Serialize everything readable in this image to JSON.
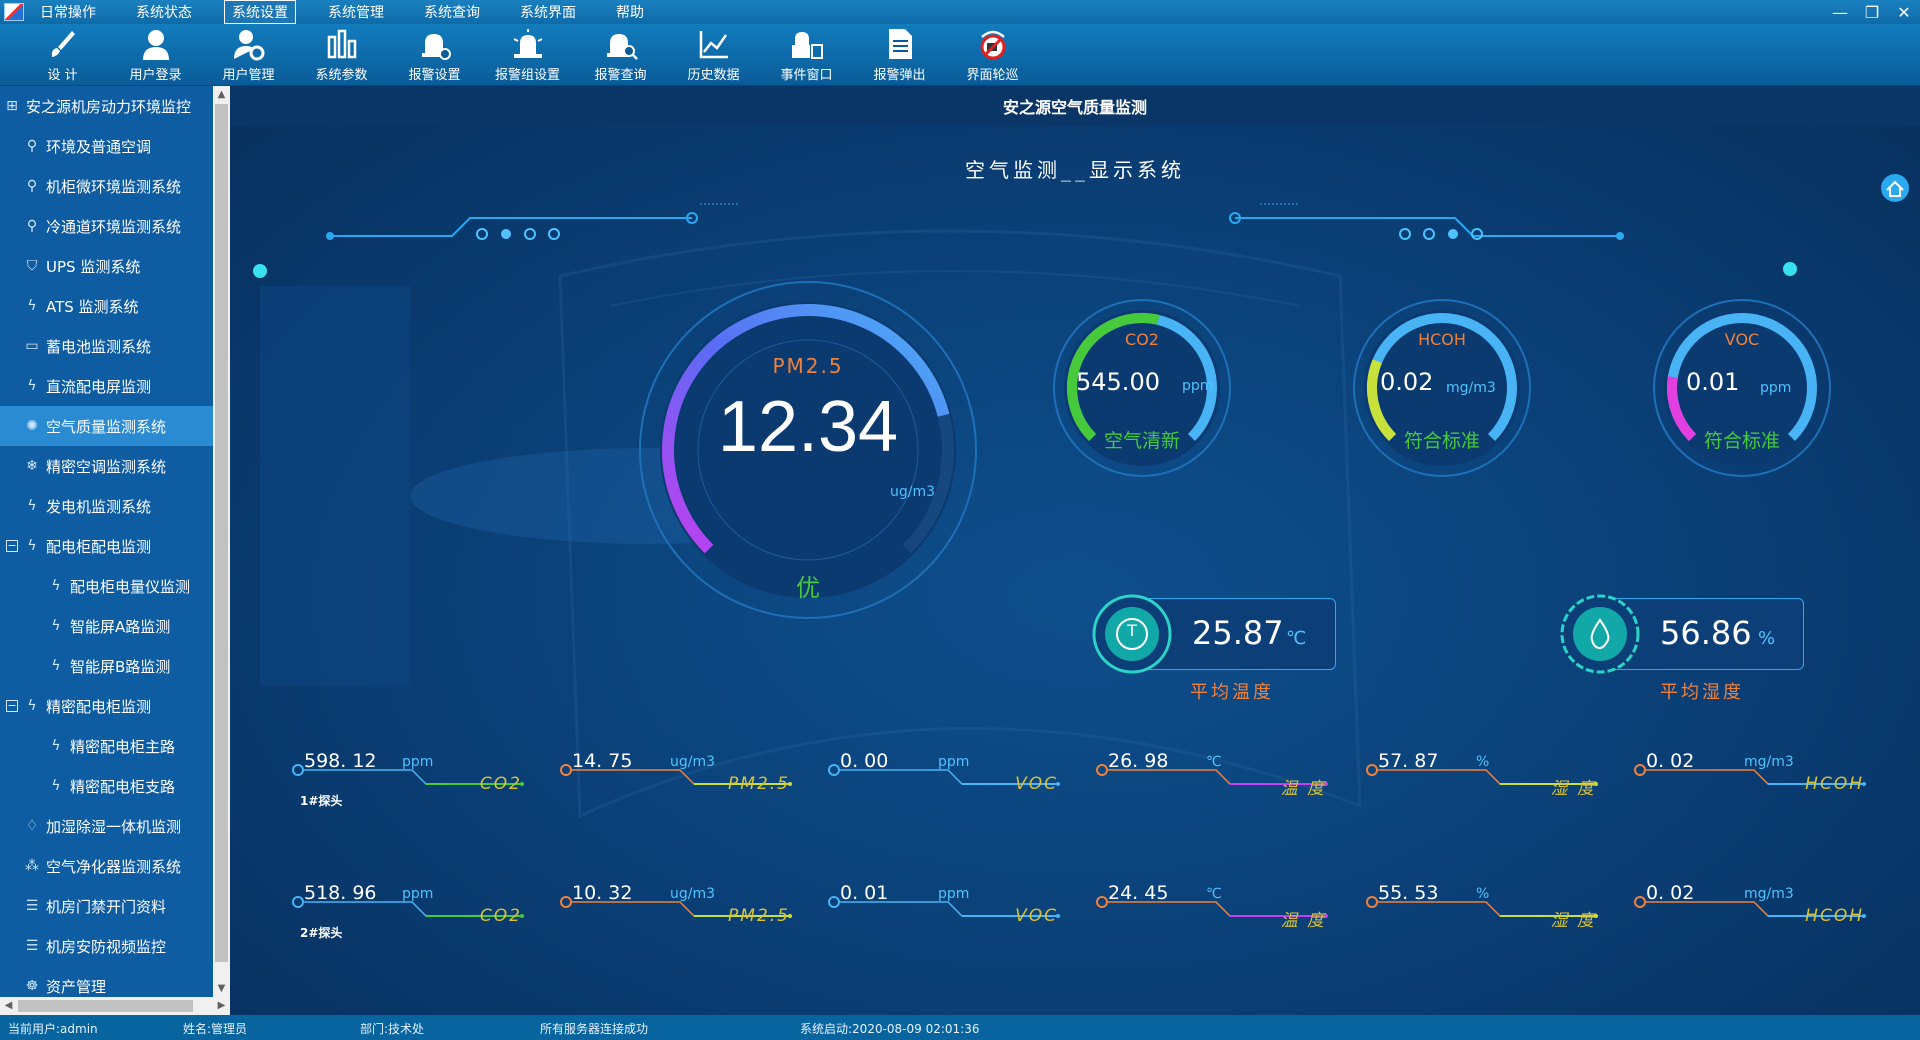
{
  "menu": [
    "日常操作",
    "系统状态",
    "系统设置",
    "系统管理",
    "系统查询",
    "系统界面",
    "帮助"
  ],
  "window_controls": [
    "—",
    "❐",
    "✕"
  ],
  "toolbar": [
    {
      "label": "设 计",
      "icon": "brush-icon"
    },
    {
      "label": "用户登录",
      "icon": "user-icon"
    },
    {
      "label": "用户管理",
      "icon": "user-gear-icon"
    },
    {
      "label": "系统参数",
      "icon": "bar-chart-icon"
    },
    {
      "label": "报警设置",
      "icon": "alarm-gear-icon"
    },
    {
      "label": "报警组设置",
      "icon": "alarm-group-icon"
    },
    {
      "label": "报警查询",
      "icon": "alarm-search-icon"
    },
    {
      "label": "历史数据",
      "icon": "line-chart-icon"
    },
    {
      "label": "事件窗口",
      "icon": "event-window-icon"
    },
    {
      "label": "报警弹出",
      "icon": "document-icon"
    },
    {
      "label": "界面轮巡",
      "icon": "no-camera-icon"
    }
  ],
  "sidebar": {
    "root": "安之源机房动力环境监控",
    "items": [
      {
        "label": "环境及普通空调",
        "icon": "branch-icon"
      },
      {
        "label": "机柜微环境监测系统",
        "icon": "branch-icon"
      },
      {
        "label": "冷通道环境监测系统",
        "icon": "branch-icon"
      },
      {
        "label": "UPS 监测系统",
        "icon": "shield-icon"
      },
      {
        "label": "ATS 监测系统",
        "icon": "bolt-icon"
      },
      {
        "label": "蓄电池监测系统",
        "icon": "battery-icon"
      },
      {
        "label": "直流配电屏监测",
        "icon": "bolt-icon"
      },
      {
        "label": "空气质量监测系统",
        "icon": "gear-icon"
      },
      {
        "label": "精密空调监测系统",
        "icon": "snowflake-icon"
      },
      {
        "label": "发电机监测系统",
        "icon": "bolt-icon"
      },
      {
        "label": "配电柜配电监测",
        "icon": "bolt-icon"
      },
      {
        "label": "配电柜电量仪监测",
        "icon": "bolt-icon"
      },
      {
        "label": "智能屏A路监测",
        "icon": "bolt-icon"
      },
      {
        "label": "智能屏B路监测",
        "icon": "bolt-icon"
      },
      {
        "label": "精密配电柜监测",
        "icon": "bolt-icon"
      },
      {
        "label": "精密配电柜主路",
        "icon": "bolt-icon"
      },
      {
        "label": "精密配电柜支路",
        "icon": "bolt-icon"
      },
      {
        "label": "加湿除湿一体机监测",
        "icon": "drop-icon"
      },
      {
        "label": "空气净化器监测系统",
        "icon": "cluster-icon"
      },
      {
        "label": "机房门禁开门资料",
        "icon": "list-icon"
      },
      {
        "label": "机房安防视频监控",
        "icon": "list-icon"
      },
      {
        "label": "资产管理",
        "icon": "asset-icon"
      }
    ]
  },
  "main": {
    "title": "安之源空气质量监测",
    "subtitle": "空气监测__显示系统",
    "pm25": {
      "label": "PM2.5",
      "value": "12.34",
      "unit": "ug/m3",
      "grade": "优",
      "fraction": 0.78
    },
    "co2": {
      "label": "CO2",
      "value": "545.00",
      "unit": "ppm",
      "status": "空气清新",
      "fraction": 0.55
    },
    "hcoh": {
      "label": "HCOH",
      "value": "0.02",
      "unit": "mg/m3",
      "status": "符合标准",
      "fraction": 0.25
    },
    "voc": {
      "label": "VOC",
      "value": "0.01",
      "unit": "ppm",
      "status": "符合标准",
      "fraction": 0.2
    },
    "temperature": {
      "value": "25.87",
      "unit": "℃",
      "label": "平均温度",
      "icon_letter": "T"
    },
    "humidity": {
      "value": "56.86",
      "unit": "%",
      "label": "平均湿度"
    },
    "probes": [
      {
        "name": "1#探头",
        "items": [
          {
            "value": "598. 12",
            "unit": "ppm",
            "label": "CO2"
          },
          {
            "value": "14. 75",
            "unit": "ug/m3",
            "label": "PM2.5"
          },
          {
            "value": "0. 00",
            "unit": "ppm",
            "label": "VOC"
          },
          {
            "value": "26. 98",
            "unit": "℃",
            "label": "温 度"
          },
          {
            "value": "57. 87",
            "unit": "%",
            "label": "湿 度"
          },
          {
            "value": "0. 02",
            "unit": "mg/m3",
            "label": "HCOH"
          }
        ]
      },
      {
        "name": "2#探头",
        "items": [
          {
            "value": "518. 96",
            "unit": "ppm",
            "label": "CO2"
          },
          {
            "value": "10. 32",
            "unit": "ug/m3",
            "label": "PM2.5"
          },
          {
            "value": "0. 01",
            "unit": "ppm",
            "label": "VOC"
          },
          {
            "value": "24. 45",
            "unit": "℃",
            "label": "温 度"
          },
          {
            "value": "55. 53",
            "unit": "%",
            "label": "湿 度"
          },
          {
            "value": "0. 02",
            "unit": "mg/m3",
            "label": "HCOH"
          }
        ]
      }
    ]
  },
  "status": {
    "user": "当前用户:admin",
    "name": "姓名:管理员",
    "dept": "部门:技术处",
    "server": "所有服务器连接成功",
    "start": "系统启动:2020-08-09 02:01:36"
  },
  "colors": {
    "accent": "#2aa8f0",
    "gauge_blue": "#49b4f5",
    "gauge_purple": "#c23ef0",
    "gauge_green": "#46c93a",
    "gauge_yellow": "#c8e13a",
    "gauge_pink": "#e23ee0",
    "orange": "#f0813a"
  }
}
